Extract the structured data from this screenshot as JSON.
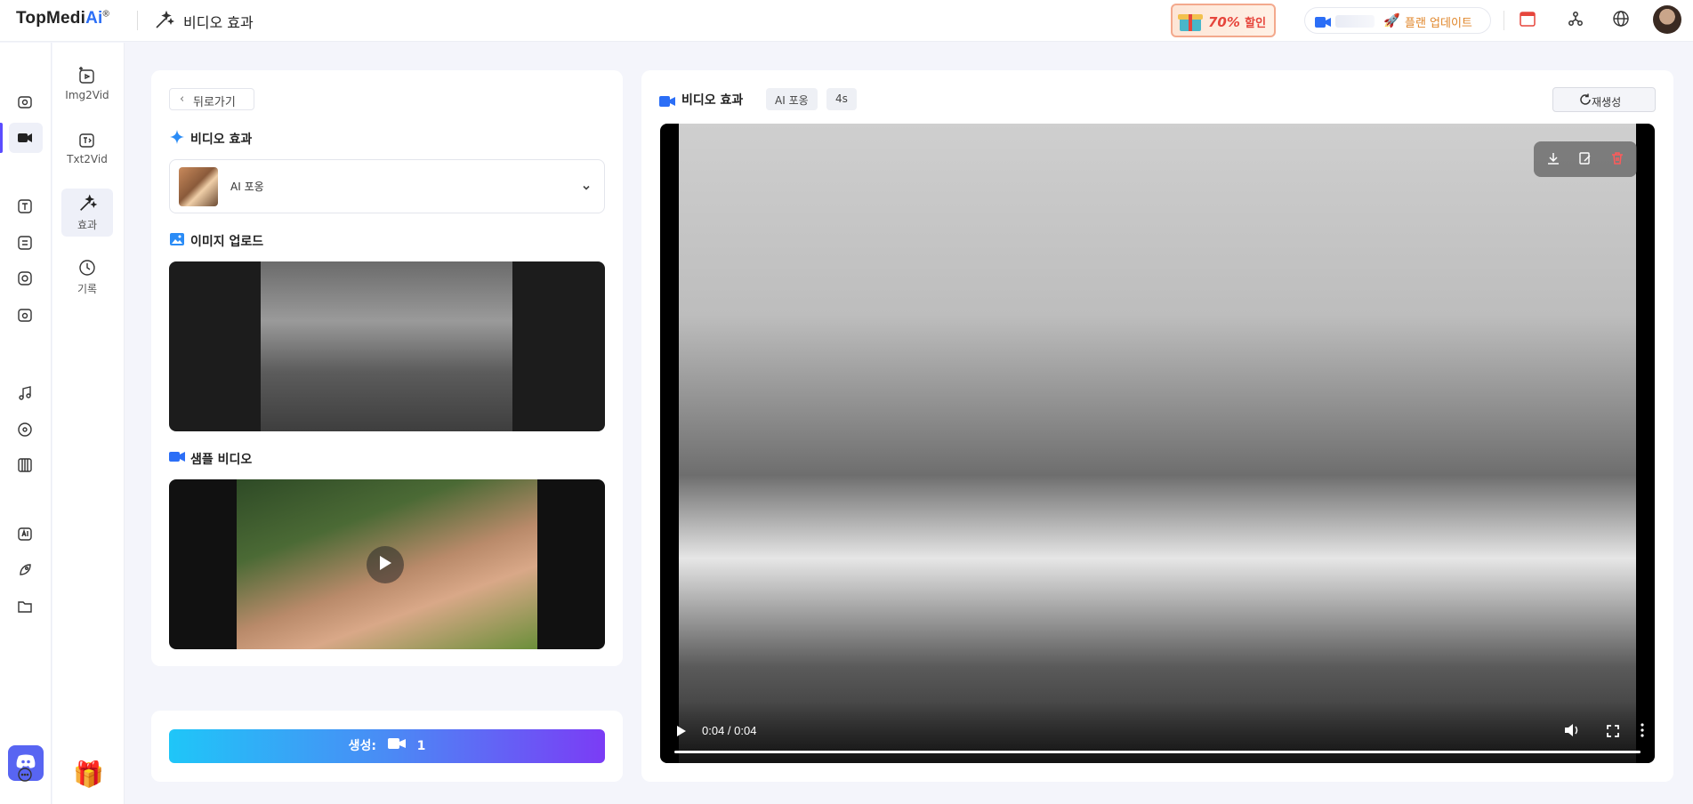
{
  "app": {
    "logo_main": "TopMedi",
    "logo_ai": "Ai",
    "logo_reg": "®",
    "page_title": "비디오 효과"
  },
  "promo": {
    "percent": "70%",
    "label": "할인"
  },
  "plan": {
    "update_label": "플랜 업데이트"
  },
  "sidebar_tools": [
    {
      "label": "Img2Vid"
    },
    {
      "label": "Txt2Vid"
    },
    {
      "label": "효과"
    },
    {
      "label": "기록"
    }
  ],
  "left_panel": {
    "back_label": "뒤로가기",
    "effect_section_title": "비디오 효과",
    "selected_effect": "AI 포옹",
    "upload_section_title": "이미지 업로드",
    "sample_section_title": "샘플 비디오"
  },
  "generate": {
    "label": "생성:",
    "count": "1"
  },
  "result": {
    "title": "비디오 효과",
    "chip_effect": "AI 포옹",
    "chip_duration": "4s",
    "regen_label": "재생성",
    "time": "0:04 / 0:04",
    "progress": 1.0
  },
  "colors": {
    "accent": "#5b4cff",
    "brand_blue": "#2b6ef6",
    "promo_red": "#e6453c",
    "delete_red": "#ff5a5a"
  }
}
